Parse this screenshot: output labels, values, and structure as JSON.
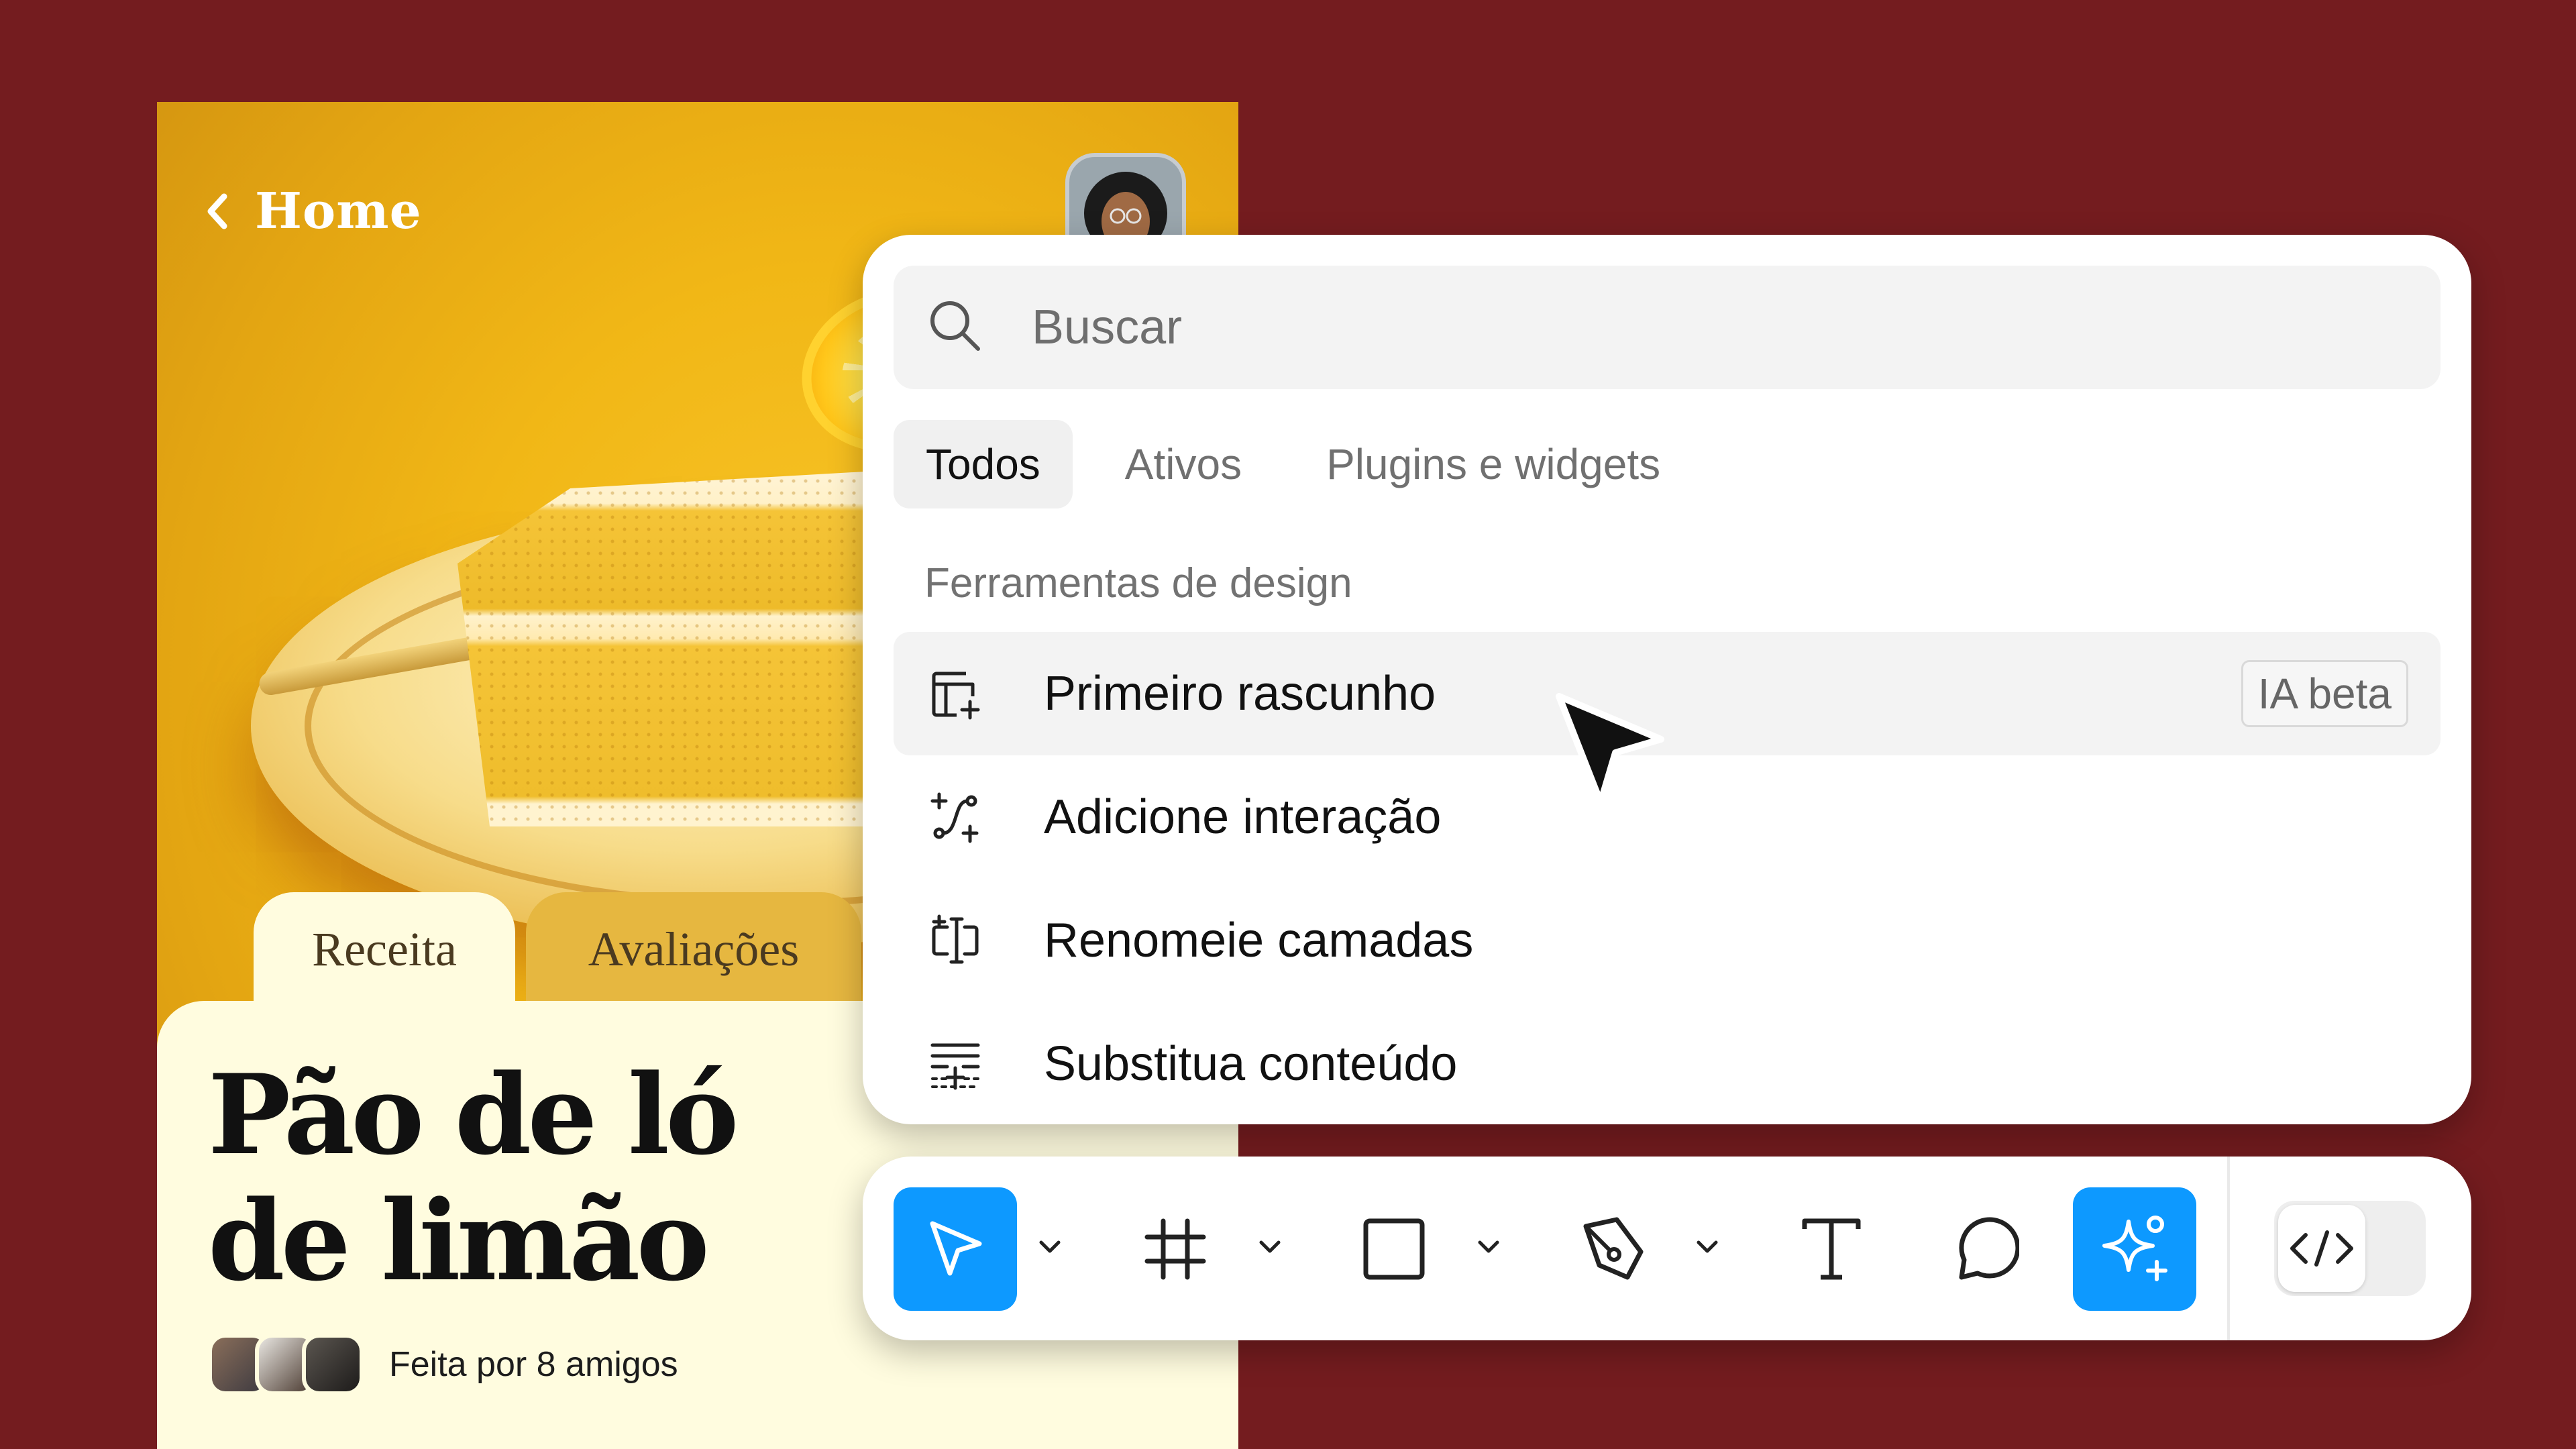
{
  "recipe_card": {
    "back_label": "Home",
    "tabs": [
      {
        "label": "Receita",
        "active": true
      },
      {
        "label": "Avaliações",
        "active": false
      }
    ],
    "title": "Pão de ló\nde limão",
    "friends_label": "Feita por 8 amigos"
  },
  "palette": {
    "search": {
      "placeholder": "Buscar",
      "value": ""
    },
    "tabs": [
      {
        "label": "Todos",
        "active": true
      },
      {
        "label": "Ativos",
        "active": false
      },
      {
        "label": "Plugins e widgets",
        "active": false
      }
    ],
    "section_title": "Ferramentas de design",
    "items": [
      {
        "label": "Primeiro rascunho",
        "icon": "layout-sparkle-icon",
        "badge": "IA beta",
        "highlighted": true
      },
      {
        "label": "Adicione interação",
        "icon": "interaction-sparkle-icon"
      },
      {
        "label": "Renomeie camadas",
        "icon": "rename-layers-icon"
      },
      {
        "label": "Substitua conteúdo",
        "icon": "replace-content-icon"
      }
    ]
  },
  "toolbar": {
    "tools": [
      {
        "name": "move-tool",
        "icon": "cursor-arrow-icon",
        "active": true
      },
      {
        "name": "frame-tool",
        "icon": "frame-hash-icon"
      },
      {
        "name": "shape-tool",
        "icon": "rectangle-icon"
      },
      {
        "name": "pen-tool",
        "icon": "pen-nib-icon"
      },
      {
        "name": "text-tool",
        "icon": "text-t-icon"
      },
      {
        "name": "comment-tool",
        "icon": "comment-bubble-icon"
      },
      {
        "name": "ai-tool",
        "icon": "sparkle-plus-icon",
        "active": true
      }
    ],
    "dev_mode_icon": "code-brackets-icon"
  },
  "colors": {
    "background": "#741c1f",
    "accent_blue": "#0d99ff",
    "card_cream": "#fffcdf",
    "card_yellow": "#f1b716"
  }
}
